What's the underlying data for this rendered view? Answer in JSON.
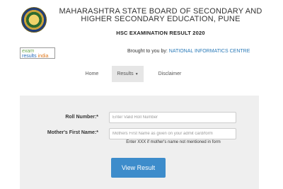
{
  "header": {
    "board_name": "MAHARASHTRA STATE BOARD OF SECONDARY AND HIGHER SECONDARY EDUCATION, PUNE",
    "result_title": "HSC EXAMINATION RESULT 2020"
  },
  "branding": {
    "logo_line1": "exam",
    "logo_line2": "results",
    "logo_line3": "india",
    "brought_prefix": "Brought to you by:",
    "brought_org": "NATIONAL INFORMATICS CENTRE"
  },
  "nav": {
    "home": "Home",
    "results": "Results",
    "disclaimer": "Disclaimer"
  },
  "form": {
    "roll_label": "Roll Number:*",
    "roll_placeholder": "Enter Valid Roll Number",
    "mother_label": "Mother's First Name:*",
    "mother_placeholder": "Mothers First Name as given on your admit card/form",
    "mother_hint": "Enter XXX if mother's name not mentioned in form",
    "submit_label": "View Result"
  },
  "colors": {
    "accent": "#3d8ccb",
    "panel": "#efefef",
    "link": "#2a7ab8"
  }
}
